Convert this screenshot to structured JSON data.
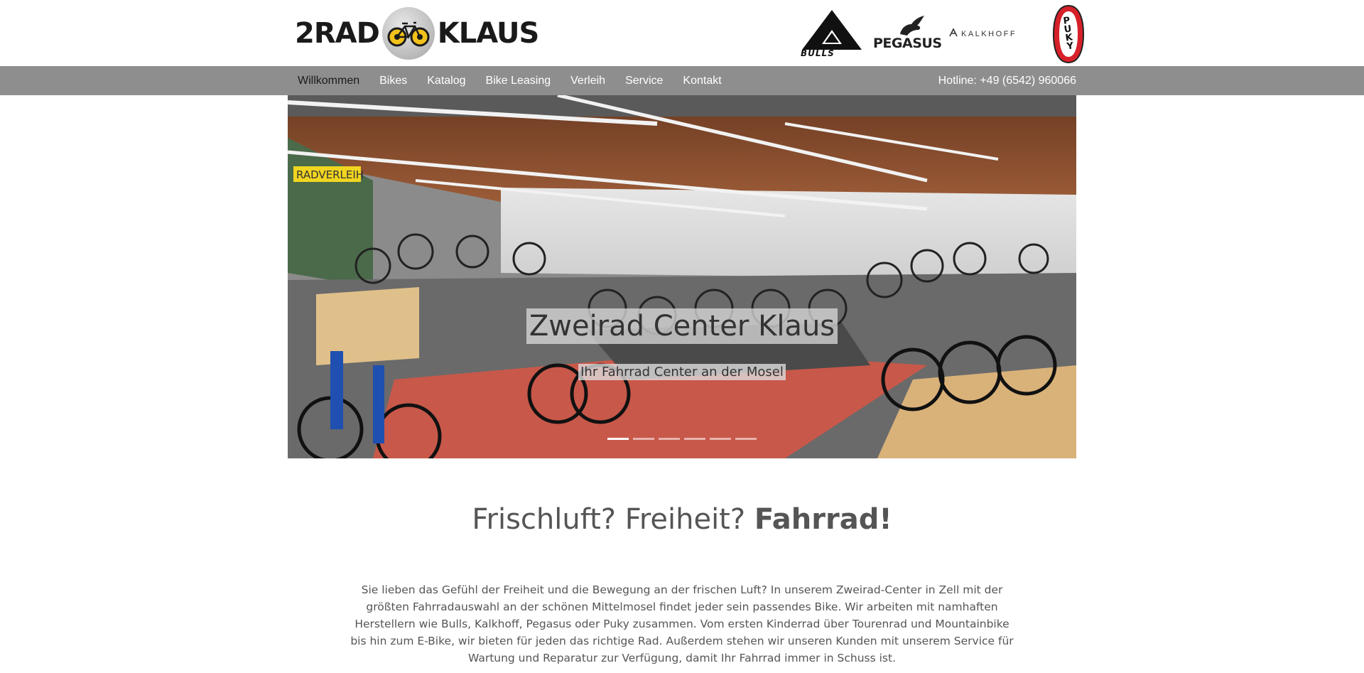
{
  "header": {
    "logo": {
      "left_text": "2RAD",
      "right_text": "KLAUS"
    },
    "brands": {
      "bulls": "BULLS",
      "pegasus": "PEGASUS",
      "kalkhoff": "KALKHOFF",
      "puky": [
        "P",
        "U",
        "K",
        "Y"
      ]
    }
  },
  "nav": {
    "items": [
      {
        "label": "Willkommen"
      },
      {
        "label": "Bikes"
      },
      {
        "label": "Katalog"
      },
      {
        "label": "Bike Leasing"
      },
      {
        "label": "Verleih"
      },
      {
        "label": "Service"
      },
      {
        "label": "Kontakt"
      }
    ],
    "hotline": "Hotline: +49 (6542) 960066"
  },
  "slider": {
    "title": "Zweirad Center Klaus",
    "subtitle": "Ihr Fahrrad Center an der Mosel",
    "sign_text": "RADVERLEIH",
    "slide_count": 6,
    "active_slide": 1
  },
  "main": {
    "headline_regular": "Frischluft? Freiheit? ",
    "headline_bold": "Fahrrad!",
    "intro": "Sie lieben das Gefühl der Freiheit und die Bewegung an der frischen Luft? In unserem Zweirad-Center in Zell mit der größten Fahrradauswahl an der schönen Mittelmosel findet jeder sein passendes Bike. Wir arbeiten mit namhaften Herstellern wie Bulls, Kalkhoff, Pegasus oder Puky zusammen. Vom ersten Kinderrad über Tourenrad und Mountainbike bis hin zum E-Bike, wir bieten für jeden das richtige Rad. Außerdem stehen wir unseren Kunden mit unserem Service für Wartung und Reparatur zur Verfügung, damit Ihr Fahrrad immer in Schuss ist."
  },
  "colors": {
    "navbar": "#8e8e8e",
    "nav_active": "#1b1b1b",
    "text": "#555555",
    "logo_yellow": "#f2c21b",
    "puky_red": "#d6202a"
  }
}
